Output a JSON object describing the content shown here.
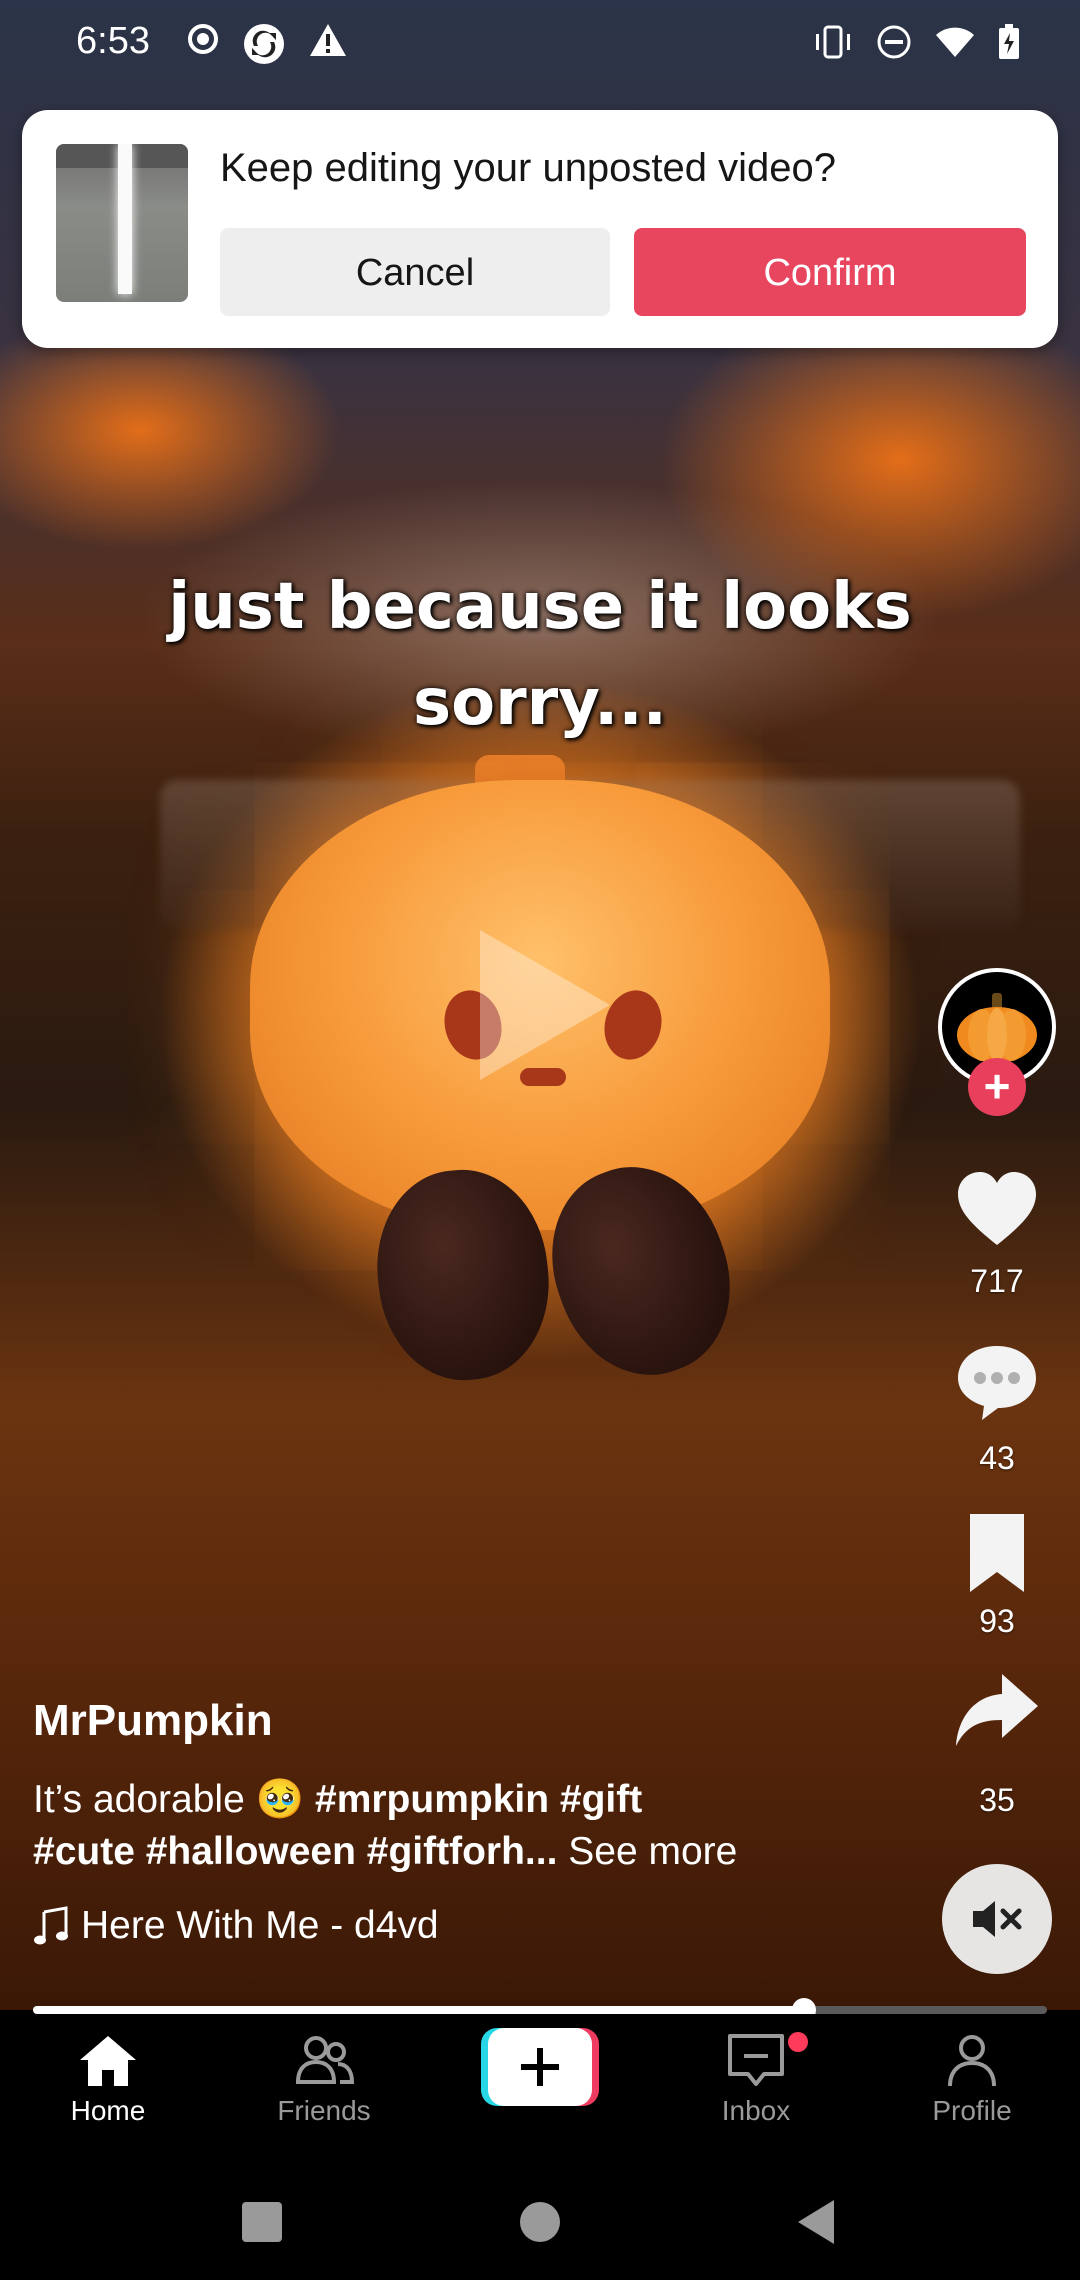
{
  "status_bar": {
    "time": "6:53"
  },
  "video": {
    "caption_overlay": [
      "just because it looks",
      "sorry..."
    ]
  },
  "draft_banner": {
    "title": "Keep editing your unposted video?",
    "cancel_label": "Cancel",
    "confirm_label": "Confirm"
  },
  "actions": {
    "likes": "717",
    "comments": "43",
    "saves": "93",
    "shares": "35"
  },
  "post": {
    "username": "MrPumpkin",
    "description_prefix": "It’s adorable 🥹 ",
    "hashtags_line1": "#mrpumpkin #gift",
    "hashtags_line2": "#cute #halloween #giftforh...",
    "see_more": "See more",
    "music": "Here With Me - d4vd"
  },
  "playback": {
    "progress": 0.76
  },
  "bottom_nav": {
    "items": [
      {
        "label": "Home",
        "active": true
      },
      {
        "label": "Friends",
        "active": false
      },
      {
        "label": "Inbox",
        "active": false
      },
      {
        "label": "Profile",
        "active": false
      }
    ]
  },
  "colors": {
    "accent": "#e8465e",
    "follow": "#e8405c"
  }
}
